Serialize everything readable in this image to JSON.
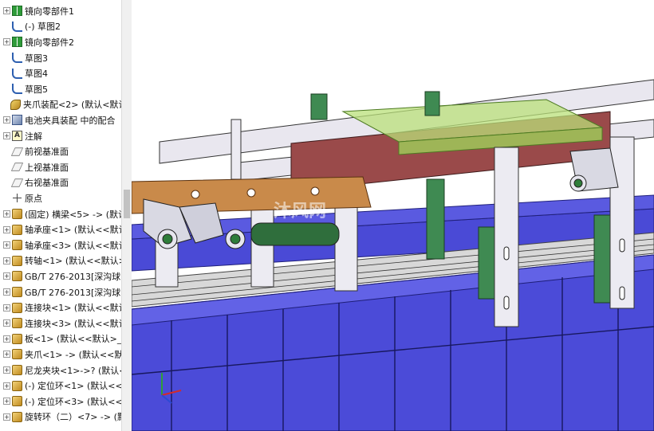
{
  "feature_tree": {
    "items": [
      {
        "label": "镜向零部件1",
        "icon": "mirror-components-icon",
        "expandable": true
      },
      {
        "label": "(-) 草图2",
        "icon": "sketch-icon",
        "expandable": false
      },
      {
        "label": "镜向零部件2",
        "icon": "mirror-components-icon",
        "expandable": true
      },
      {
        "label": "草图3",
        "icon": "sketch-icon",
        "expandable": false
      },
      {
        "label": "草图4",
        "icon": "sketch-icon",
        "expandable": false
      },
      {
        "label": "草图5",
        "icon": "sketch-icon",
        "expandable": false
      },
      {
        "label": "夹爪装配<2> (默认<默认_",
        "icon": "assembly-icon",
        "expandable": false
      },
      {
        "label": "电池夹具装配 中的配合",
        "icon": "mates-icon",
        "expandable": true
      },
      {
        "label": "注解",
        "icon": "annotations-icon",
        "expandable": true
      },
      {
        "label": "前视基准面",
        "icon": "plane-icon",
        "expandable": false
      },
      {
        "label": "上视基准面",
        "icon": "plane-icon",
        "expandable": false
      },
      {
        "label": "右视基准面",
        "icon": "plane-icon",
        "expandable": false
      },
      {
        "label": "原点",
        "icon": "origin-icon",
        "expandable": false
      },
      {
        "label": "(固定) 横梁<5> -> (默认",
        "icon": "part-icon",
        "expandable": true
      },
      {
        "label": "轴承座<1> (默认<<默认",
        "icon": "part-icon",
        "expandable": true
      },
      {
        "label": "轴承座<3> (默认<<默认",
        "icon": "part-icon",
        "expandable": true
      },
      {
        "label": "转轴<1> (默认<<默认>_",
        "icon": "part-icon",
        "expandable": true
      },
      {
        "label": "GB/T 276-2013[深沟球",
        "icon": "part-icon",
        "expandable": true
      },
      {
        "label": "GB/T 276-2013[深沟球",
        "icon": "part-icon",
        "expandable": true
      },
      {
        "label": "连接块<1> (默认<<默认",
        "icon": "part-icon",
        "expandable": true
      },
      {
        "label": "连接块<3> (默认<<默认",
        "icon": "part-icon",
        "expandable": true
      },
      {
        "label": "板<1> (默认<<默认>_",
        "icon": "part-icon",
        "expandable": true
      },
      {
        "label": "夹爪<1> -> (默认<<默认",
        "icon": "part-icon",
        "expandable": true
      },
      {
        "label": "尼龙夹块<1>->? (默认<",
        "icon": "part-icon",
        "expandable": true
      },
      {
        "label": "(-) 定位环<1> (默认<<",
        "icon": "part-icon",
        "expandable": true
      },
      {
        "label": "(-) 定位环<3> (默认<<",
        "icon": "part-icon",
        "expandable": true
      },
      {
        "label": "旋转环（二）<7> -> (默",
        "icon": "part-icon",
        "expandable": true
      }
    ]
  },
  "viewport": {
    "watermark": "沐风网",
    "colors": {
      "conveyor_blue": "#4b4bd8",
      "frame_light": "#e6e4ec",
      "plate_green": "#b9e07a",
      "bracket_green": "#3f8a52",
      "gripper_orange": "#c98a4a",
      "beam_maroon": "#9a4a4a"
    }
  }
}
